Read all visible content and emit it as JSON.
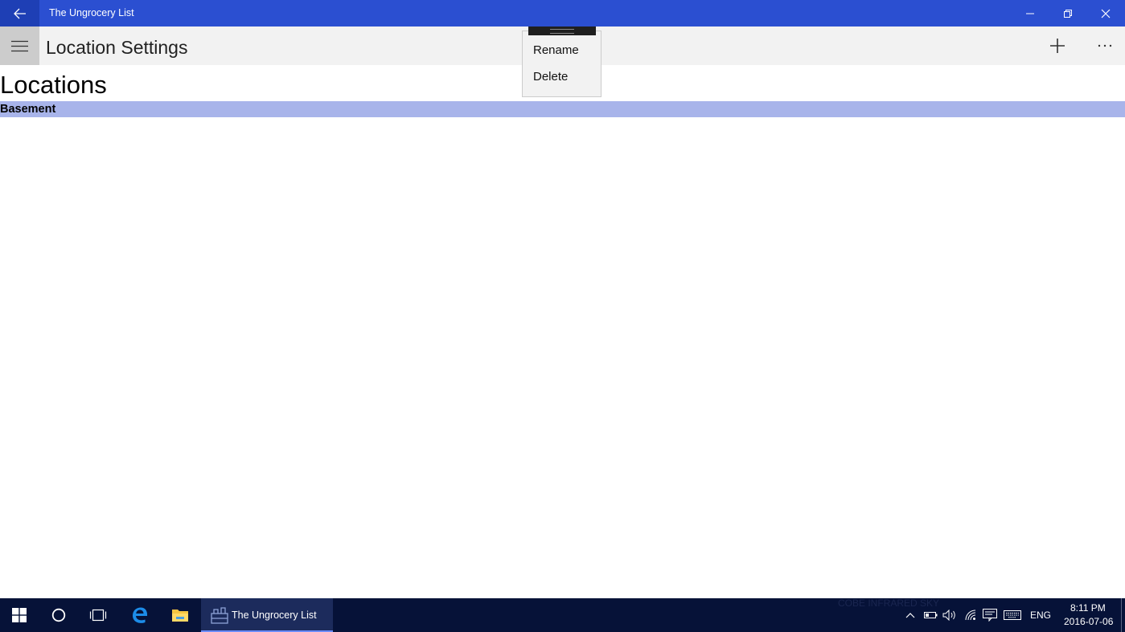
{
  "window": {
    "app_title": "The Ungrocery List"
  },
  "commandbar": {
    "page_title": "Location Settings"
  },
  "content": {
    "heading": "Locations",
    "locations": [
      "Basement"
    ]
  },
  "context_menu": {
    "items": [
      "Rename",
      "Delete"
    ]
  },
  "taskbar": {
    "active_app_label": "The Ungrocery List",
    "watermark": "COBE INFRARED SKY",
    "language": "ENG",
    "time": "8:11 PM",
    "date": "2016-07-06"
  },
  "colors": {
    "titlebar": "#2b4fd1",
    "selection": "#a8b4ea",
    "taskbar": "#061238"
  },
  "icons": {
    "back": "back-arrow-icon",
    "menu": "hamburger-icon",
    "add": "plus-icon",
    "more": "more-ellipsis-icon"
  }
}
